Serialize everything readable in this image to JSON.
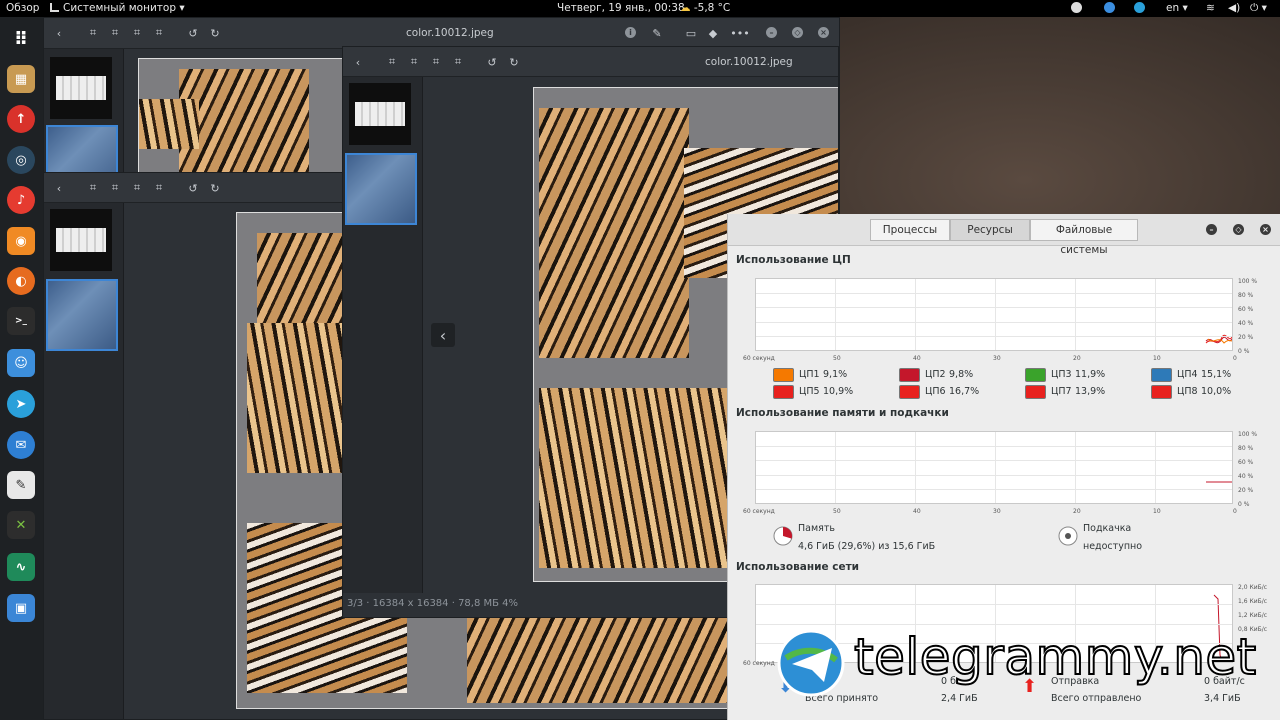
{
  "topbar": {
    "overview": "Обзор",
    "app_menu": "Системный монитор ▾",
    "clock": "Четверг, 19 янв., 00:38",
    "weather": "-5,8 °C",
    "language": "en ▾"
  },
  "dock": {
    "icons": [
      "apps-grid-icon",
      "archive-icon",
      "upload-icon",
      "steam-icon",
      "music-icon",
      "rss-icon",
      "firefox-icon",
      "terminal-icon",
      "finder-icon",
      "telegram-icon",
      "mail-icon",
      "gimp-icon",
      "inkscape-icon",
      "system-monitor-icon",
      "image-viewer-icon"
    ]
  },
  "viewer_front": {
    "title": "color.10012.jpeg",
    "status": "3/3 · 16384 x 16384 · 78,8 МБ     4%"
  },
  "viewer_back": {
    "title": "color.10012.jpeg"
  },
  "sysmon": {
    "tabs": [
      "Процессы",
      "Ресурсы",
      "Файловые системы"
    ],
    "active_tab": "Ресурсы",
    "cpu": {
      "title": "Использование ЦП",
      "y_ticks": [
        "100 %",
        "80 %",
        "60 %",
        "40 %",
        "20 %",
        "0 %"
      ],
      "x_ticks": [
        "60 секунд",
        "50",
        "40",
        "30",
        "20",
        "10",
        "0"
      ],
      "cores": [
        {
          "label": "ЦП1",
          "value": "9,1%",
          "color": "#f57900"
        },
        {
          "label": "ЦП2",
          "value": "9,8%",
          "color": "#c4172b"
        },
        {
          "label": "ЦП3",
          "value": "11,9%",
          "color": "#3aa32b"
        },
        {
          "label": "ЦП4",
          "value": "15,1%",
          "color": "#2e7ab8"
        },
        {
          "label": "ЦП5",
          "value": "10,9%",
          "color": "#e8211e"
        },
        {
          "label": "ЦП6",
          "value": "16,7%",
          "color": "#e8211e"
        },
        {
          "label": "ЦП7",
          "value": "13,9%",
          "color": "#e8211e"
        },
        {
          "label": "ЦП8",
          "value": "10,0%",
          "color": "#e8211e"
        }
      ]
    },
    "memory": {
      "title": "Использование памяти и подкачки",
      "y_ticks": [
        "100 %",
        "80 %",
        "60 %",
        "40 %",
        "20 %",
        "0 %"
      ],
      "x_ticks": [
        "60 секунд",
        "50",
        "40",
        "30",
        "20",
        "10",
        "0"
      ],
      "mem_label": "Память",
      "mem_value": "4,6 ГиБ (29,6%) из 15,6 ГиБ",
      "mem_fraction": 0.296,
      "swap_label": "Подкачка",
      "swap_value": "недоступно"
    },
    "network": {
      "title": "Использование сети",
      "y_ticks": [
        "2,0 КиБ/с",
        "1,6 КиБ/с",
        "1,2 КиБ/с",
        "0,8 КиБ/с"
      ],
      "x_tick_first": "60 секунд",
      "recv_label": "Всего принято",
      "recv_value": "2,4 ГиБ",
      "recv_rate": "0 б",
      "send_label": "Отправка",
      "send_rate": "0 байт/с",
      "sent_label": "Всего отправлено",
      "sent_value": "3,4 ГиБ"
    }
  },
  "watermark": "telegrammy.net"
}
